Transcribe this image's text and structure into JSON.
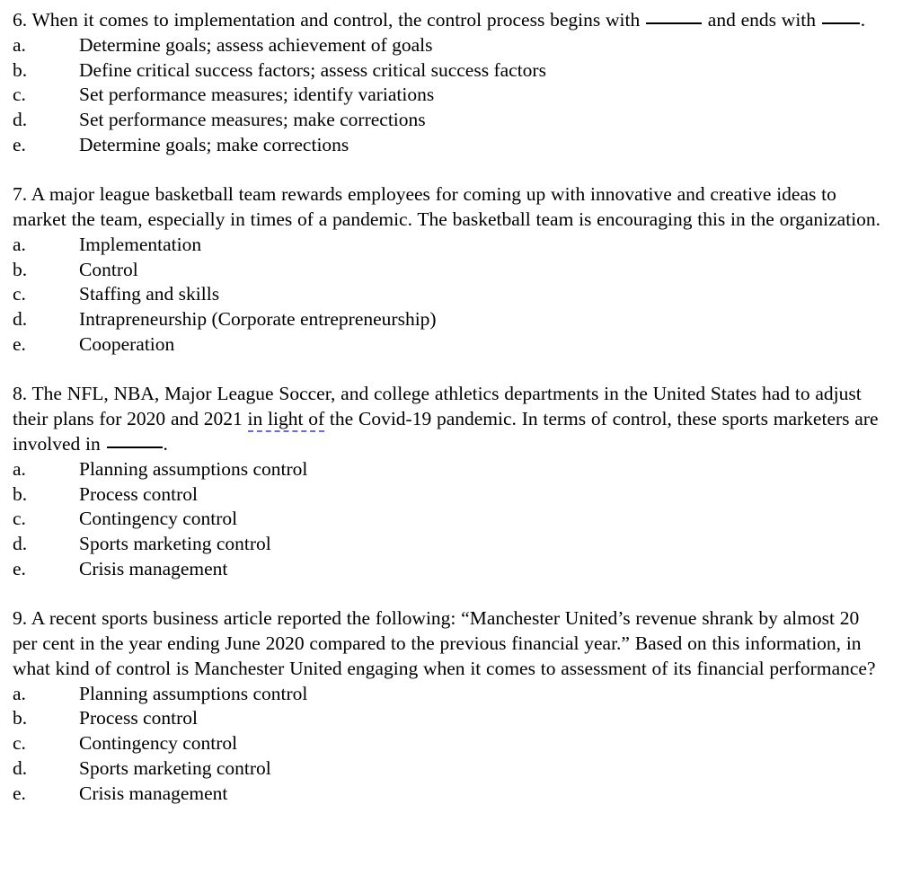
{
  "document": {
    "type": "multiple-choice-exam-questions",
    "background_color": "#ffffff",
    "text_color": "#000000",
    "grammar_underline_color": "#6b6bd6"
  },
  "questions": [
    {
      "number": "6.",
      "stem_parts": {
        "p1": "6. When it comes to implementation and control, the control process begins with ",
        "blank1": "",
        "p2": " and ends with ",
        "blank2": "",
        "p3": "."
      },
      "options": [
        {
          "letter": "a.",
          "text": "Determine goals; assess achievement of goals"
        },
        {
          "letter": "b.",
          "text": "Define critical success factors; assess critical success factors"
        },
        {
          "letter": "c.",
          "text": "Set performance measures; identify variations"
        },
        {
          "letter": "d.",
          "text": "Set performance measures; make corrections"
        },
        {
          "letter": "e.",
          "text": "Determine goals; make corrections"
        }
      ]
    },
    {
      "number": "7.",
      "stem_parts": {
        "p1": "7. A major league basketball team rewards employees for coming up with innovative and creative ideas to market the team, especially in times of a pandemic. The basketball team is encouraging this in the organization."
      },
      "options": [
        {
          "letter": "a.",
          "text": "Implementation"
        },
        {
          "letter": "b.",
          "text": "Control"
        },
        {
          "letter": "c.",
          "text": "Staffing and skills"
        },
        {
          "letter": "d.",
          "text": "Intrapreneurship (Corporate entrepreneurship)"
        },
        {
          "letter": "e.",
          "text": "Cooperation"
        }
      ]
    },
    {
      "number": "8.",
      "stem_parts": {
        "p1": "8. The NFL, NBA, Major League Soccer, and college athletics departments in the United States had to adjust their plans for 2020 and 2021 ",
        "grammar_flagged": "in light of",
        "p2": " the Covid-19 pandemic. In terms of control, these sports marketers are involved in ",
        "blank1": "",
        "p3": "."
      },
      "options": [
        {
          "letter": "a.",
          "text": "Planning assumptions control"
        },
        {
          "letter": "b.",
          "text": "Process control"
        },
        {
          "letter": "c.",
          "text": "Contingency control"
        },
        {
          "letter": "d.",
          "text": "Sports marketing control"
        },
        {
          "letter": "e.",
          "text": "Crisis management"
        }
      ]
    },
    {
      "number": "9.",
      "stem_parts": {
        "p1": "9. A recent sports business article reported the following: “Manchester United’s revenue shrank by almost 20 per cent in the year ending June 2020 compared to the previous financial year.” Based on this information, in what kind of control is Manchester United engaging when it comes to assessment of its financial performance?"
      },
      "options": [
        {
          "letter": "a.",
          "text": "Planning assumptions control"
        },
        {
          "letter": "b.",
          "text": "Process control"
        },
        {
          "letter": "c.",
          "text": "Contingency control"
        },
        {
          "letter": "d.",
          "text": "Sports marketing control"
        },
        {
          "letter": "e.",
          "text": "Crisis management"
        }
      ]
    }
  ]
}
